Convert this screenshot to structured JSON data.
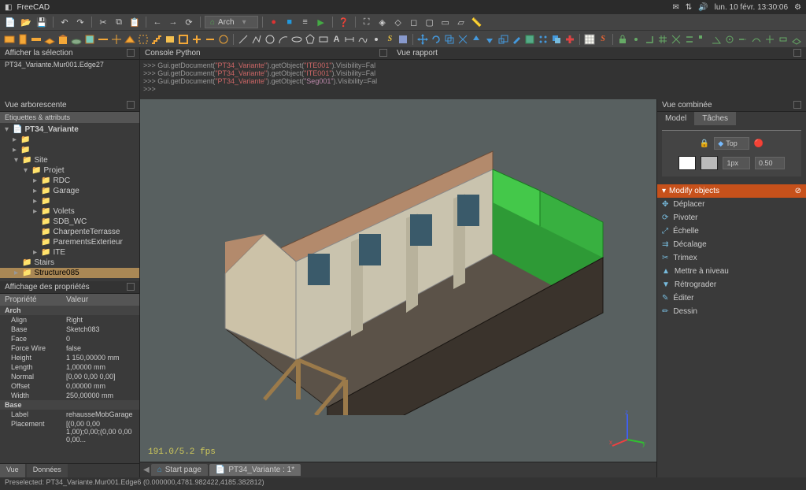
{
  "app": {
    "title": "FreeCAD",
    "clock": "lun. 10 févr. 13:30:06"
  },
  "menubar": {
    "workbench": "Arch"
  },
  "selection": {
    "panel_title": "Afficher la sélection",
    "text": "PT34_Variante.Mur001.Edge27"
  },
  "console": {
    "title": "Console Python",
    "lines": [
      ">>> Gui.getDocument(\"PT34_Variante\").getObject(\"ITE001\").Visibility=Fal",
      ">>> Gui.getDocument(\"PT34_Variante\").getObject(\"ITE001\").Visibility=Fal",
      ">>> Gui.getDocument(\"PT34_Variante\").getObject(\"Seg001\").Visibility=Fal",
      ">>>"
    ]
  },
  "report": {
    "title": "Vue rapport"
  },
  "tree": {
    "title": "Vue arborescente",
    "header": "Etiquettes & attributs",
    "root": "PT34_Variante",
    "items": [
      {
        "indent": 1,
        "tw": "▾",
        "label": "Site"
      },
      {
        "indent": 2,
        "tw": "▾",
        "label": "Projet"
      },
      {
        "indent": 3,
        "tw": "▸",
        "label": "RDC"
      },
      {
        "indent": 3,
        "tw": "▸",
        "label": "Garage"
      },
      {
        "indent": 3,
        "tw": "▸",
        "label": ""
      },
      {
        "indent": 3,
        "tw": "▸",
        "label": "Volets"
      },
      {
        "indent": 3,
        "tw": "",
        "label": "SDB_WC"
      },
      {
        "indent": 3,
        "tw": "",
        "label": "CharpenteTerrasse"
      },
      {
        "indent": 3,
        "tw": "",
        "label": "ParementsExterieur"
      },
      {
        "indent": 3,
        "tw": "▸",
        "label": "ITE"
      },
      {
        "indent": 1,
        "tw": "",
        "label": "Stairs"
      },
      {
        "indent": 1,
        "tw": "▸",
        "label": "Structure085",
        "sel": true
      }
    ]
  },
  "properties": {
    "title": "Affichage des propriétés",
    "col_prop": "Propriété",
    "col_val": "Valeur",
    "groups": [
      {
        "name": "Arch",
        "rows": [
          {
            "k": "Align",
            "v": "Right"
          },
          {
            "k": "Base",
            "v": "Sketch083"
          },
          {
            "k": "Face",
            "v": "0"
          },
          {
            "k": "Force Wire",
            "v": "false"
          },
          {
            "k": "Height",
            "v": "1 150,00000 mm"
          },
          {
            "k": "Length",
            "v": "1,00000 mm"
          },
          {
            "k": "Normal",
            "v": "[0,00 0,00 0,00]"
          },
          {
            "k": "Offset",
            "v": "0,00000 mm"
          },
          {
            "k": "Width",
            "v": "250,00000 mm"
          }
        ]
      },
      {
        "name": "Base",
        "rows": [
          {
            "k": "Label",
            "v": "rehausseMobGarage"
          },
          {
            "k": "Placement",
            "v": "[(0,00 0,00 1,00);0,00;(0,00 0,00 0,00..."
          }
        ]
      }
    ],
    "tabs": {
      "view": "Vue",
      "data": "Données"
    }
  },
  "viewport": {
    "fps": "191.0/5.2 fps",
    "tabs": {
      "start": "Start page",
      "doc": "PT34_Variante : 1*"
    }
  },
  "combined": {
    "title": "Vue combinée",
    "tab_model": "Model",
    "tab_tasks": "Tâches",
    "top_label": "Top",
    "px": "1px",
    "val": "0.50",
    "section": "Modify objects",
    "items": [
      "Déplacer",
      "Pivoter",
      "Échelle",
      "Décalage",
      "Trimex",
      "Mettre à niveau",
      "Rétrograder",
      "Éditer",
      "Dessin"
    ]
  },
  "status": "Preselected: PT34_Variante.Mur001.Edge6 (0.000000,4781.982422,4185.382812)"
}
